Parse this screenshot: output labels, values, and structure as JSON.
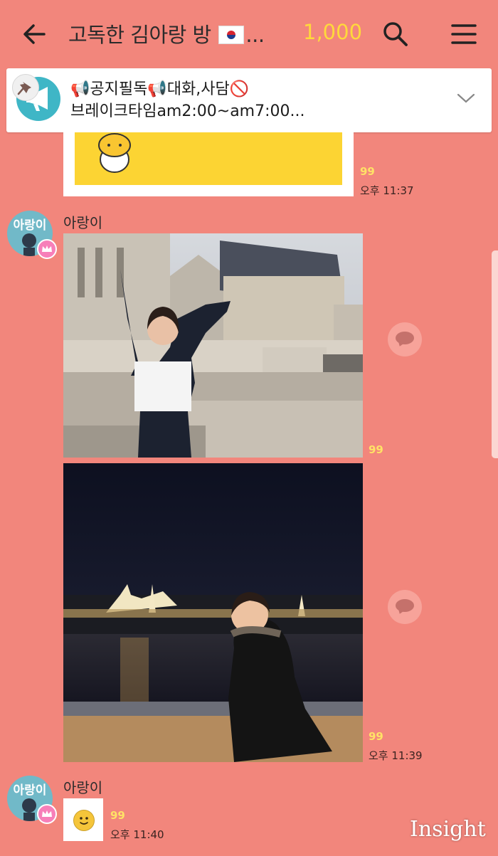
{
  "header": {
    "title_text": "고독한 김아랑 방",
    "title_ellipsis": "...",
    "member_count": "1,000"
  },
  "notice": {
    "line1": "📢공지필독📢대화,사담🚫",
    "line2": "브레이크타임am2:00~am7:00..."
  },
  "messages": [
    {
      "type": "photo",
      "read_count": "99",
      "time": "오후 11:37"
    },
    {
      "sender": "아랑이",
      "avatar_text": "아랑이",
      "type": "photo",
      "read_count": "99",
      "time": ""
    },
    {
      "type": "photo",
      "read_count": "99",
      "time": "오후 11:39"
    },
    {
      "sender": "아랑이",
      "avatar_text": "아랑이",
      "type": "emoticon",
      "read_count": "99",
      "time": "오후 11:40"
    }
  ],
  "watermark": "Insight",
  "colors": {
    "background": "#f2867c",
    "member_count": "#ffd93b",
    "read_count": "#ffe266",
    "notice_icon": "#3fb6c6",
    "avatar": "#71b9c8"
  }
}
